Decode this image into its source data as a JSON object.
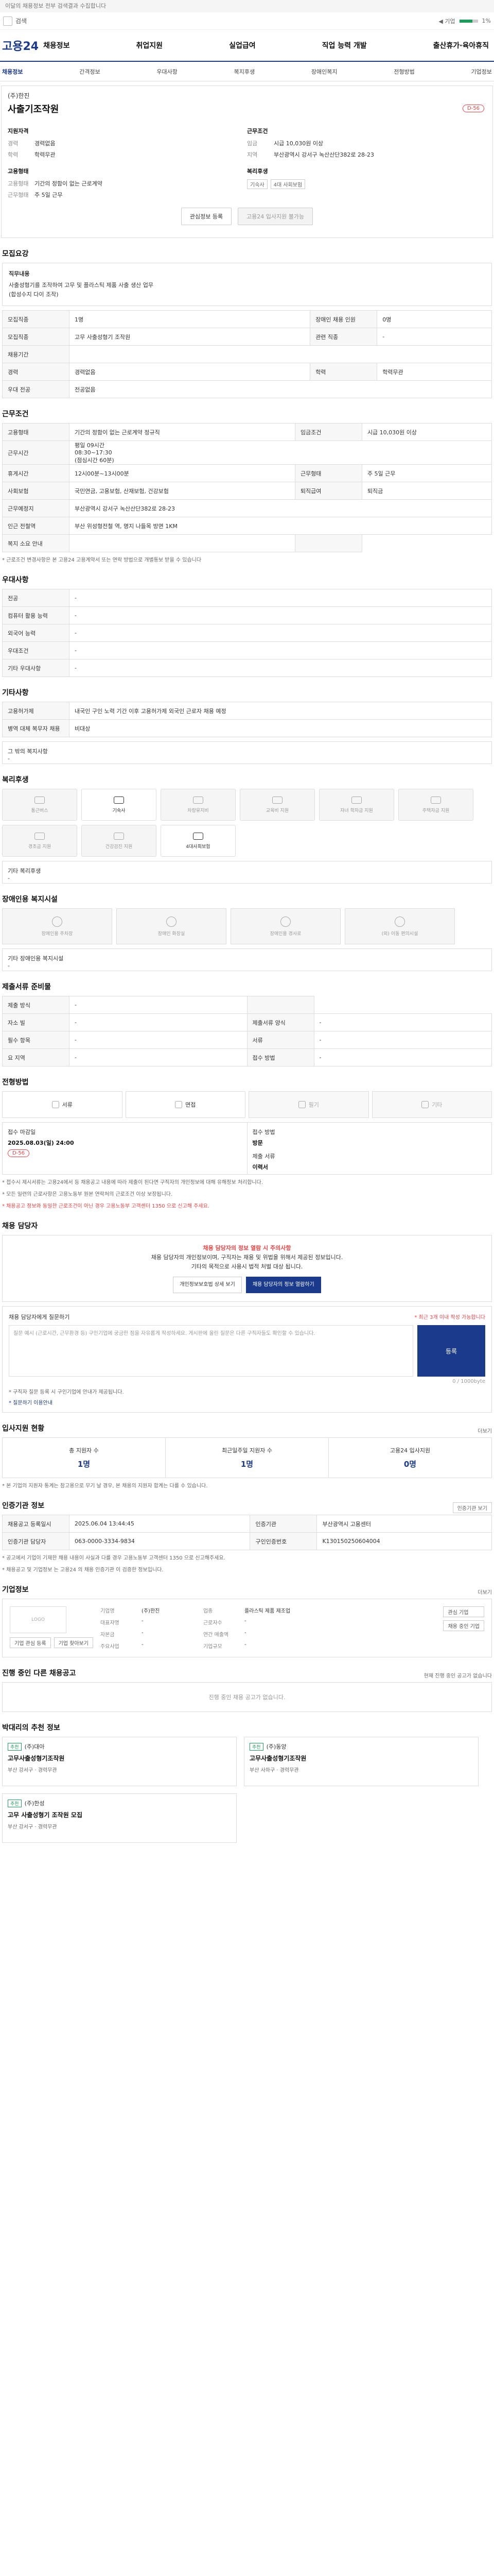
{
  "top_note": "이달의 채용정보 전부 검색결과 수집합니다",
  "search": {
    "value": "검색",
    "right_label": "◀ 기업",
    "pct_label": "1%",
    "pct": 0.7
  },
  "logo": "고용24",
  "nav": [
    "채용정보",
    "취업지원",
    "실업급여",
    "직업 능력 개발",
    "출산휴가·육아휴직"
  ],
  "subnav": [
    "채용정보",
    "간격정보",
    "우대사항",
    "복지후생",
    "장애인복지",
    "전형방법",
    "기업정보"
  ],
  "header": {
    "company": "(주)한진",
    "title": "사출기조작원",
    "dday": "D-56",
    "left_title": "지원자격",
    "left": [
      {
        "k": "경력",
        "v": "경력없음"
      },
      {
        "k": "학력",
        "v": "학력무관"
      }
    ],
    "left2_title": "고용형태",
    "left2": [
      {
        "k": "고용형태",
        "v": "기간의 정함이 없는 근로계약"
      },
      {
        "k": "근무형태",
        "v": "주 5일 근무"
      }
    ],
    "right_title": "근무조건",
    "right": [
      {
        "k": "임금",
        "v": "시급 10,030원 이상"
      },
      {
        "k": "지역",
        "v": "부산광역시 강서구 녹산산단382로 28-23"
      }
    ],
    "right2_title": "복리후생",
    "badges": [
      "기숙사",
      "4대 사회보험"
    ],
    "btn_share": "관심정보 등록",
    "btn_apply": "고용24 입사지원 불가능"
  },
  "sec_recruit": "모집요강",
  "job": {
    "label": "직무내용",
    "lines": [
      "사출성형기를 조작하여 고무 및 플라스틱 제품 사출 생산 업무",
      "(합성수지 다이 조작)"
    ]
  },
  "recruit_rows": [
    [
      "모집직종",
      "1명",
      "장애인 채용 인원",
      "0명"
    ],
    [
      "모집직종",
      "고무 사출성형기 조작원",
      "관련 직종",
      "-"
    ],
    [
      "채용기간",
      "",
      "",
      ""
    ],
    [
      "경력",
      "경력없음",
      "학력",
      "학력무관"
    ],
    [
      "우대 전공",
      "전공없음",
      "",
      ""
    ]
  ],
  "sec_cond": "근무조건",
  "cond_rows": [
    [
      "고용형태",
      "기간의 정함이 없는 근로계약 정규직",
      "임금조건",
      "시급 10,030원 이상"
    ],
    [
      "근무시간",
      "평일 09시간\n08:30~17:30\n(점심시간 60분)",
      "",
      ""
    ],
    [
      "휴게시간",
      "12시00분~13시00분",
      "근무형태",
      "주 5일 근무"
    ],
    [
      "사회보험",
      "국민연금, 고용보험, 산재보험, 건강보험",
      "퇴직급여",
      "퇴직금"
    ],
    [
      "근무예정지",
      "부산광역시 강서구 녹산산단382로 28-23",
      "",
      ""
    ],
    [
      "인근 전철역",
      "부산 위성형전철 역, 명지 나들목 방면 1KM",
      "",
      ""
    ],
    [
      "복지 소요 안내",
      "",
      "",
      " "
    ]
  ],
  "cond_note": "* 근로조건 변경사항은 본 고용24 고용계약서 또는 연락 방법으로 개별통보 받을 수 있습니다",
  "sec_pref": "우대사항",
  "pref_rows": [
    [
      "전공",
      "-"
    ],
    [
      "컴퓨터 활용 능력",
      "-"
    ],
    [
      "외국어 능력",
      "-"
    ],
    [
      "우대조건",
      "-"
    ],
    [
      "기타 우대사항",
      "-"
    ]
  ],
  "sec_etc": "기타사항",
  "etc_rows": [
    [
      "고용허가제",
      "내국인 구인 노력 기간 이후 고용허가제 외국인 근로자 채용 예정"
    ],
    [
      "병역 대체 복무자 채용",
      "비대상"
    ]
  ],
  "etc_box_label": "그 밖의 복지사항",
  "etc_box_val": "-",
  "sec_welfare": "복리후생",
  "welfare": [
    {
      "l": "통근버스",
      "on": false
    },
    {
      "l": "기숙사",
      "on": true
    },
    {
      "l": "차량유지비",
      "on": false
    },
    {
      "l": "교육비 지원",
      "on": false
    },
    {
      "l": "자녀 학자금 지원",
      "on": false
    },
    {
      "l": "주택자금 지원",
      "on": false
    },
    {
      "l": "경조금 지원",
      "on": false
    },
    {
      "l": "건강검진 지원",
      "on": false
    },
    {
      "l": "4대사회보험",
      "on": true
    }
  ],
  "welfare_box_label": "기타 복리후생",
  "welfare_box_val": "-",
  "sec_disabled": "장애인용 복지시설",
  "disabled": [
    "장애인용 주차장",
    "장애인 화장실",
    "장애인용 경사로",
    "(외) 이동 편의시설"
  ],
  "dis_box_label": "기타 장애인용 복지시설",
  "dis_box_val": "-",
  "sec_req": "제출서류 준비물",
  "req_rows": [
    [
      "제출 방식",
      "-",
      "",
      " "
    ],
    [
      "자소 빌",
      "-",
      "제출서류 양식",
      "-"
    ],
    [
      "필수 항목",
      "-",
      "서류",
      "-"
    ],
    [
      "요 지역",
      "-",
      "접수 방법",
      "-"
    ]
  ],
  "sec_proc": "전형방법",
  "proc": [
    {
      "l": "서류",
      "on": true
    },
    {
      "l": "면접",
      "on": true
    },
    {
      "l": "필기",
      "on": false
    },
    {
      "l": "기타",
      "on": false
    }
  ],
  "dates": {
    "c1_label": "접수 마감일",
    "c1_val": "2025.08.03(일) 24:00",
    "c1_badge": "D-56",
    "c2_label": "접수 방법",
    "c2_val": "방문",
    "c3_label": "제출 서류",
    "c3_val": "이력서"
  },
  "proc_notes": [
    "* 접수시 제시서류는 고용24에서 등 채용공고 내용에 따라 제출이 된다면 구직자의 개인정보에 대해 유해정보 처리합니다.",
    "* 모든 일련의 근로사항은 고용노동부 원본 연락처의 근로조건 이상 보장됩니다.",
    "* 채용공고 정보와 동일한 근로조건이 아닌 경우 고용노동부 고객센터 1350 으로 신고해 주세요."
  ],
  "sec_contact": "채용 담당자",
  "contact": {
    "warn": "채용 담당자의 정보 열람 시 주의사항",
    "l1": "채용 담당자의 개인정보이며, 구직자는 채용 및 위법을 위해서 제공된 정보입니다.",
    "l2": "기타의 목적으로 사용시 법적 처벌 대상 됩니다.",
    "btn1": "개인정보보호법 상세 보기",
    "btn2": "채용 담당자의 정보 열람하기"
  },
  "q": {
    "title": "채용 담당자에게 질문하기",
    "note": "* 최근 3개 이내 작성 가능합니다",
    "placeholder": "질문 예시 (근로시간, 근무환경 등) 구인기업에 궁금한 점을 자유롭게 작성하세요. 게시판에 올린 질문은 다른 구직자들도 확인할 수 있습니다.",
    "submit": "등록",
    "count": "0 / 1000byte",
    "n1": "* 구직자 질문 등록 시 구인기업에 안내가 제공됩니다.",
    "n2": "* 질문하기 이용안내"
  },
  "sec_stats": "입사지원 현황",
  "stats_more": "더보기",
  "stats": [
    {
      "l": "총 지원자 수",
      "n": "1명"
    },
    {
      "l": "최근일주일 지원자 수",
      "n": "1명"
    },
    {
      "l": "고용24 입사지원",
      "n": "0명"
    }
  ],
  "stats_note": "* 본 기업의 지원자 통계는 참고용으로 무기 날 경우, 본 채용의 지원자 합계는 다를 수 있습니다.",
  "sec_org": "인증기관 정보",
  "org_btn": "인증기관 보기",
  "org_rows": [
    [
      "채용공고 등록일시",
      "2025.06.04 13:44:45",
      "인증기관",
      "부산광역시 고용센터"
    ],
    [
      "인증기관 담당자",
      "063-0000-3334-9834",
      "구인인증번호",
      "K130150250604004"
    ]
  ],
  "org_notes": [
    "* 공고에서 기업이 기재한 채용 내용이 사실과 다를 경우 고용노동부 고객센터 1350 으로 신고해주세요.",
    "* 채용공고 및 기업정보 는 고용24 의 채용 인증기관 이 검증한 정보입니다."
  ],
  "sec_co": "기업정보",
  "co_more": "더보기",
  "co": {
    "logo": "LOGO",
    "b1": "기업 관심 등록",
    "b2": "기업 찾아보기",
    "keys": [
      "기업명",
      "업종",
      "대표자명",
      "근로자수",
      "자본금",
      "연간 매출액",
      "주요사업",
      "기업규모"
    ],
    "vals": [
      "(주)한진",
      "플라스틱 제품 제조업",
      "-",
      "-",
      "-",
      "-",
      "-",
      "-"
    ],
    "r1": "관심 기업",
    "r2": "채용 중인 기업"
  },
  "sec_others": "진행 중인 다른 채용공고",
  "others_note": "현재 진행 중인 공고가 없습니다",
  "others_empty": "진행 중인 채용 공고가 없습니다.",
  "sec_rec": "박대리의 추천 정보",
  "recs": [
    {
      "tag": "추천",
      "co": "(주)대아",
      "t": "고무사출성형기조작원",
      "m": "부산 강서구 · 경력무관"
    },
    {
      "tag": "추천",
      "co": "(주)동양",
      "t": "고무사출성형기조작원",
      "m": "부산 사하구 · 경력무관"
    },
    {
      "tag": "추천",
      "co": "(주)한성",
      "t": "고무 사출성형기 조작원 모집",
      "m": "부산 강서구 · 경력무관"
    }
  ]
}
